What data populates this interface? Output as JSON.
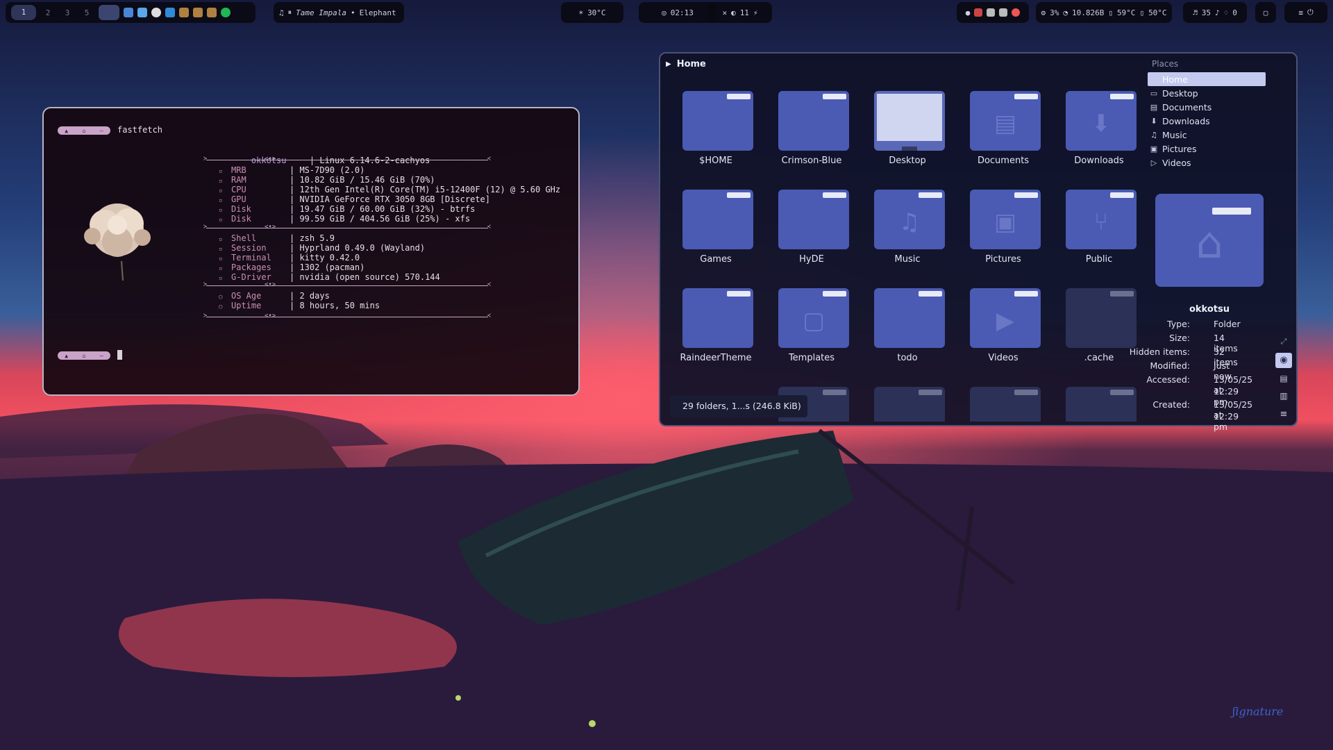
{
  "topbar": {
    "workspaces": [
      "1",
      "2",
      "3",
      "5"
    ],
    "media": {
      "artist": "Tame Impala",
      "separator": "•",
      "track": "Elephant"
    },
    "weather": "30°C",
    "clock": "02:13",
    "notifications": "11",
    "stats": [
      "3%",
      "10.826B",
      "59°C",
      "50°C"
    ],
    "audio": [
      "35",
      "0"
    ]
  },
  "terminal": {
    "title": "fastfetch",
    "user": "okkotsu",
    "os": "Linux 6.14.6-2-cachyos",
    "rows_hw": [
      {
        "key": "MRB",
        "value": "MS-7D90 (2.0)"
      },
      {
        "key": "RAM",
        "value": "10.82 GiB / 15.46 GiB (70%)"
      },
      {
        "key": "CPU",
        "value": "12th Gen Intel(R) Core(TM) i5-12400F (12) @ 5.60 GHz"
      },
      {
        "key": "GPU",
        "value": "NVIDIA GeForce RTX 3050 8GB [Discrete]"
      },
      {
        "key": "Disk",
        "value": "19.47 GiB / 60.00 GiB (32%) - btrfs"
      },
      {
        "key": "Disk",
        "value": "99.59 GiB / 404.56 GiB (25%) - xfs"
      }
    ],
    "rows_sw": [
      {
        "key": "Shell",
        "value": "zsh 5.9"
      },
      {
        "key": "Session",
        "value": "Hyprland 0.49.0 (Wayland)"
      },
      {
        "key": "Terminal",
        "value": "kitty 0.42.0"
      },
      {
        "key": "Packages",
        "value": "1302 (pacman)"
      },
      {
        "key": "G-Driver",
        "value": "nvidia (open source) 570.144"
      }
    ],
    "rows_time": [
      {
        "key": "OS Age",
        "value": "2 days"
      },
      {
        "key": "Uptime",
        "value": "8 hours, 50 mins"
      }
    ]
  },
  "filemanager": {
    "breadcrumb": "Home",
    "places_title": "Places",
    "places": [
      "Home",
      "Desktop",
      "Documents",
      "Downloads",
      "Music",
      "Pictures",
      "Videos"
    ],
    "folders": [
      "$HOME",
      "Crimson-Blue",
      "Desktop",
      "Documents",
      "Downloads",
      "Games",
      "HyDE",
      "Music",
      "Pictures",
      "Public",
      "RaindeerTheme",
      "Templates",
      "todo",
      "Videos",
      ".cache"
    ],
    "status": "29 folders, 1...s (246.8 KiB)",
    "info": {
      "name": "okkotsu",
      "type_label": "Type:",
      "type": "Folder",
      "size_label": "Size:",
      "size": "14 items",
      "hidden_label": "Hidden items:",
      "hidden": "32 items",
      "modified_label": "Modified:",
      "modified": "Just now",
      "accessed_label": "Accessed:",
      "accessed_1": "13/05/25 at",
      "accessed_2": "12:29 pm",
      "created_label": "Created:",
      "created_1": "13/05/25 at",
      "created_2": "12:29 pm"
    }
  }
}
